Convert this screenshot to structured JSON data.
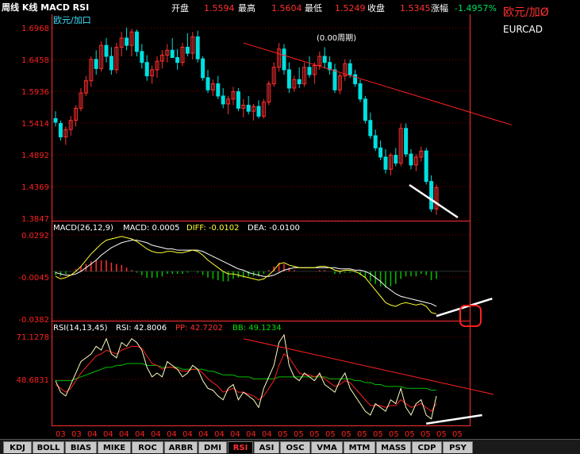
{
  "header": {
    "title": "周线 K线 MACD RSI",
    "open_label": "开盘",
    "open_value": "1.5594",
    "high_label": "最高",
    "high_value": "1.5604",
    "low_label": "最低",
    "low_value": "1.5249",
    "close_label": "收盘",
    "close_value": "1.5345",
    "change_label": "涨幅",
    "change_value": "-1.4957%"
  },
  "right_panel": {
    "name_cn": "欧元/加Ø",
    "name_en": "EURCAD"
  },
  "price_panel": {
    "label": "欧元/加口",
    "annotation": "(0.00周期)",
    "y_ticks": [
      "1.6968",
      "1.6458",
      "1.5936",
      "1.5414",
      "1.4892",
      "1.4369",
      "1.3847"
    ]
  },
  "macd_panel": {
    "label": "MACD(26,12,9)",
    "macd_text": "MACD: 0.0005",
    "diff_text": "DIFF: -0.0102",
    "dea_text": "DEA: -0.0100",
    "y_ticks": [
      "0.0292",
      "-0.0045",
      "-0.0382"
    ]
  },
  "rsi_panel": {
    "label": "RSI(14,13,45)",
    "rsi_text": "RSI: 42.8006",
    "pp_text": "PP: 42.7202",
    "bb_text": "BB: 49.1234",
    "y_ticks": [
      "71.1278",
      "48.6831"
    ]
  },
  "x_ticks": [
    "03",
    "03",
    "04",
    "04",
    "04",
    "04",
    "04",
    "04",
    "04",
    "04",
    "04",
    "04",
    "04",
    "04",
    "05",
    "05",
    "05",
    "05",
    "05",
    "05",
    "05",
    "05",
    "05",
    "05",
    "05",
    "05"
  ],
  "tabs": [
    "KDJ",
    "BOLL",
    "BIAS",
    "MIKE",
    "ROC",
    "ARBR",
    "DMI",
    "RSI",
    "ASI",
    "OSC",
    "VMA",
    "MTM",
    "MASS",
    "CDP",
    "PSY"
  ],
  "active_tab": "RSI",
  "colors": {
    "up": "#ff3030",
    "down": "#00e0e0",
    "grid": "#800000",
    "axis": "#ff3030",
    "yellow": "#ffff30",
    "white": "#ffffff",
    "green": "#00c000",
    "red": "#ff2020"
  },
  "chart_data": [
    {
      "type": "candlestick",
      "ylim": [
        1.3847,
        1.6968
      ],
      "candles": [
        [
          1.548,
          1.56,
          1.535,
          1.542
        ],
        [
          1.54,
          1.545,
          1.512,
          1.518
        ],
        [
          1.518,
          1.535,
          1.505,
          1.53
        ],
        [
          1.53,
          1.552,
          1.52,
          1.545
        ],
        [
          1.545,
          1.57,
          1.535,
          1.565
        ],
        [
          1.565,
          1.598,
          1.56,
          1.59
        ],
        [
          1.59,
          1.618,
          1.585,
          1.61
        ],
        [
          1.61,
          1.65,
          1.6,
          1.645
        ],
        [
          1.645,
          1.66,
          1.62,
          1.63
        ],
        [
          1.63,
          1.675,
          1.625,
          1.668
        ],
        [
          1.668,
          1.68,
          1.64,
          1.65
        ],
        [
          1.65,
          1.665,
          1.62,
          1.628
        ],
        [
          1.628,
          1.672,
          1.622,
          1.665
        ],
        [
          1.665,
          1.69,
          1.65,
          1.68
        ],
        [
          1.68,
          1.697,
          1.66,
          1.668
        ],
        [
          1.668,
          1.695,
          1.65,
          1.69
        ],
        [
          1.69,
          1.694,
          1.65,
          1.658
        ],
        [
          1.658,
          1.67,
          1.63,
          1.64
        ],
        [
          1.64,
          1.652,
          1.61,
          1.618
        ],
        [
          1.618,
          1.635,
          1.605,
          1.628
        ],
        [
          1.628,
          1.65,
          1.615,
          1.642
        ],
        [
          1.642,
          1.66,
          1.63,
          1.652
        ],
        [
          1.652,
          1.67,
          1.64,
          1.66
        ],
        [
          1.66,
          1.68,
          1.648,
          1.648
        ],
        [
          1.648,
          1.662,
          1.628,
          1.64
        ],
        [
          1.64,
          1.672,
          1.634,
          1.665
        ],
        [
          1.665,
          1.688,
          1.65,
          1.655
        ],
        [
          1.655,
          1.69,
          1.645,
          1.682
        ],
        [
          1.682,
          1.692,
          1.64,
          1.646
        ],
        [
          1.646,
          1.65,
          1.61,
          1.615
        ],
        [
          1.615,
          1.628,
          1.59,
          1.595
        ],
        [
          1.595,
          1.612,
          1.585,
          1.605
        ],
        [
          1.605,
          1.618,
          1.58,
          1.585
        ],
        [
          1.585,
          1.598,
          1.565,
          1.572
        ],
        [
          1.572,
          1.585,
          1.555,
          1.58
        ],
        [
          1.58,
          1.6,
          1.57,
          1.592
        ],
        [
          1.592,
          1.598,
          1.56,
          1.565
        ],
        [
          1.565,
          1.58,
          1.55,
          1.57
        ],
        [
          1.57,
          1.585,
          1.555,
          1.56
        ],
        [
          1.56,
          1.572,
          1.545,
          1.568
        ],
        [
          1.568,
          1.578,
          1.548,
          1.552
        ],
        [
          1.552,
          1.58,
          1.548,
          1.575
        ],
        [
          1.575,
          1.61,
          1.57,
          1.605
        ],
        [
          1.605,
          1.64,
          1.6,
          1.632
        ],
        [
          1.632,
          1.672,
          1.625,
          1.662
        ],
        [
          1.662,
          1.67,
          1.62,
          1.628
        ],
        [
          1.628,
          1.64,
          1.59,
          1.598
        ],
        [
          1.598,
          1.618,
          1.592,
          1.612
        ],
        [
          1.612,
          1.632,
          1.598,
          1.605
        ],
        [
          1.605,
          1.64,
          1.6,
          1.632
        ],
        [
          1.632,
          1.65,
          1.615,
          1.62
        ],
        [
          1.62,
          1.64,
          1.605,
          1.635
        ],
        [
          1.635,
          1.658,
          1.628,
          1.65
        ],
        [
          1.65,
          1.665,
          1.63,
          1.64
        ],
        [
          1.64,
          1.65,
          1.62,
          1.628
        ],
        [
          1.628,
          1.638,
          1.59,
          1.595
        ],
        [
          1.595,
          1.622,
          1.588,
          1.618
        ],
        [
          1.618,
          1.645,
          1.61,
          1.638
        ],
        [
          1.638,
          1.645,
          1.615,
          1.62
        ],
        [
          1.62,
          1.628,
          1.6,
          1.605
        ],
        [
          1.605,
          1.612,
          1.575,
          1.58
        ],
        [
          1.58,
          1.585,
          1.54,
          1.545
        ],
        [
          1.545,
          1.558,
          1.515,
          1.52
        ],
        [
          1.52,
          1.53,
          1.495,
          1.5
        ],
        [
          1.5,
          1.512,
          1.48,
          1.485
        ],
        [
          1.485,
          1.498,
          1.458,
          1.465
        ],
        [
          1.465,
          1.492,
          1.455,
          1.488
        ],
        [
          1.488,
          1.5,
          1.47,
          1.475
        ],
        [
          1.475,
          1.54,
          1.47,
          1.532
        ],
        [
          1.532,
          1.54,
          1.485,
          1.49
        ],
        [
          1.49,
          1.498,
          1.465,
          1.472
        ],
        [
          1.472,
          1.49,
          1.462,
          1.485
        ],
        [
          1.485,
          1.502,
          1.478,
          1.495
        ],
        [
          1.495,
          1.5,
          1.44,
          1.445
        ],
        [
          1.445,
          1.455,
          1.395,
          1.4
        ],
        [
          1.4,
          1.44,
          1.39,
          1.435
        ]
      ],
      "trendline": [
        [
          37,
          1.672
        ],
        [
          83,
          1.555
        ]
      ]
    },
    {
      "type": "line",
      "ylim": [
        -0.0382,
        0.0292
      ],
      "series": [
        {
          "name": "DIFF",
          "values": [
            -0.004,
            -0.006,
            -0.005,
            -0.003,
            0.0,
            0.004,
            0.009,
            0.014,
            0.018,
            0.022,
            0.025,
            0.026,
            0.027,
            0.028,
            0.027,
            0.026,
            0.024,
            0.021,
            0.018,
            0.016,
            0.015,
            0.015,
            0.016,
            0.016,
            0.015,
            0.015,
            0.016,
            0.017,
            0.016,
            0.013,
            0.009,
            0.006,
            0.003,
            0.0,
            -0.002,
            -0.002,
            -0.003,
            -0.004,
            -0.005,
            -0.006,
            -0.007,
            -0.006,
            -0.003,
            0.001,
            0.006,
            0.007,
            0.005,
            0.004,
            0.003,
            0.003,
            0.003,
            0.003,
            0.004,
            0.004,
            0.003,
            0.001,
            0.0,
            0.001,
            0.001,
            0.0,
            -0.002,
            -0.005,
            -0.01,
            -0.015,
            -0.02,
            -0.025,
            -0.027,
            -0.028,
            -0.026,
            -0.025,
            -0.026,
            -0.027,
            -0.026,
            -0.028,
            -0.033,
            -0.034
          ]
        },
        {
          "name": "DEA",
          "values": [
            -0.001,
            -0.002,
            -0.003,
            -0.003,
            -0.002,
            0.0,
            0.003,
            0.006,
            0.009,
            0.013,
            0.016,
            0.019,
            0.021,
            0.023,
            0.024,
            0.025,
            0.025,
            0.024,
            0.023,
            0.021,
            0.02,
            0.019,
            0.018,
            0.018,
            0.017,
            0.017,
            0.017,
            0.017,
            0.017,
            0.016,
            0.014,
            0.012,
            0.01,
            0.008,
            0.006,
            0.004,
            0.002,
            0.001,
            -0.001,
            -0.002,
            -0.003,
            -0.004,
            -0.004,
            -0.003,
            -0.001,
            0.001,
            0.002,
            0.003,
            0.003,
            0.003,
            0.003,
            0.003,
            0.003,
            0.003,
            0.003,
            0.003,
            0.002,
            0.002,
            0.002,
            0.001,
            0.001,
            0.0,
            -0.002,
            -0.005,
            -0.008,
            -0.012,
            -0.015,
            -0.018,
            -0.02,
            -0.021,
            -0.022,
            -0.023,
            -0.024,
            -0.025,
            -0.026,
            -0.028
          ]
        },
        {
          "name": "MACD",
          "type": "histogram",
          "values": [
            -0.003,
            -0.004,
            -0.002,
            0.0,
            0.002,
            0.004,
            0.006,
            0.008,
            0.009,
            0.009,
            0.009,
            0.007,
            0.006,
            0.005,
            0.003,
            0.001,
            -0.001,
            -0.003,
            -0.005,
            -0.005,
            -0.005,
            -0.004,
            -0.002,
            -0.002,
            -0.002,
            -0.002,
            -0.001,
            0.0,
            -0.001,
            -0.003,
            -0.005,
            -0.006,
            -0.007,
            -0.008,
            -0.008,
            -0.006,
            -0.005,
            -0.005,
            -0.004,
            -0.004,
            -0.004,
            -0.002,
            0.001,
            0.004,
            0.007,
            0.006,
            0.003,
            0.001,
            0.0,
            0.0,
            0.0,
            0.0,
            0.001,
            0.001,
            0.0,
            -0.002,
            -0.002,
            -0.001,
            -0.001,
            -0.001,
            -0.003,
            -0.005,
            -0.008,
            -0.01,
            -0.012,
            -0.013,
            -0.012,
            -0.01,
            -0.006,
            -0.004,
            -0.004,
            -0.004,
            -0.002,
            -0.003,
            -0.007,
            -0.006
          ]
        }
      ],
      "trendline": [
        [
          75,
          -0.0358
        ],
        [
          86,
          -0.0218
        ]
      ]
    },
    {
      "type": "line",
      "ylim": [
        25,
        71.1278
      ],
      "series": [
        {
          "name": "RSI",
          "values": [
            48,
            42,
            40,
            46,
            52,
            58,
            60,
            62,
            66,
            64,
            70,
            62,
            60,
            68,
            66,
            70,
            68,
            64,
            55,
            50,
            52,
            50,
            58,
            56,
            54,
            50,
            52,
            56,
            54,
            48,
            44,
            43,
            40,
            38,
            44,
            46,
            38,
            42,
            40,
            38,
            34,
            44,
            50,
            56,
            68,
            72,
            56,
            50,
            48,
            52,
            50,
            48,
            52,
            46,
            44,
            42,
            48,
            52,
            44,
            40,
            36,
            32,
            30,
            36,
            34,
            32,
            38,
            36,
            44,
            34,
            30,
            36,
            38,
            30,
            28,
            40
          ]
        },
        {
          "name": "PP",
          "values": [
            46,
            44,
            42,
            44,
            48,
            52,
            55,
            58,
            61,
            62,
            64,
            63,
            62,
            64,
            65,
            66,
            66,
            65,
            61,
            57,
            56,
            54,
            55,
            55,
            54,
            53,
            53,
            54,
            54,
            52,
            49,
            47,
            45,
            42,
            43,
            44,
            42,
            42,
            41,
            40,
            38,
            40,
            44,
            48,
            56,
            62,
            60,
            56,
            52,
            51,
            51,
            50,
            51,
            49,
            47,
            45,
            46,
            48,
            47,
            44,
            41,
            38,
            35,
            35,
            35,
            34,
            35,
            35,
            38,
            36,
            34,
            35,
            36,
            34,
            32,
            36
          ]
        },
        {
          "name": "BB",
          "values": [
            48,
            48,
            48,
            48,
            49,
            50,
            51,
            52,
            53,
            54,
            55,
            55,
            56,
            56,
            57,
            57,
            57,
            57,
            56,
            56,
            56,
            55,
            55,
            55,
            55,
            54,
            54,
            54,
            54,
            54,
            53,
            53,
            52,
            51,
            51,
            51,
            50,
            50,
            50,
            49,
            49,
            49,
            49,
            49,
            50,
            50,
            50,
            50,
            50,
            50,
            50,
            50,
            50,
            50,
            49,
            49,
            49,
            49,
            49,
            48,
            48,
            47,
            47,
            46,
            46,
            45,
            45,
            45,
            45,
            44,
            44,
            44,
            44,
            44,
            43,
            43
          ]
        }
      ],
      "trendlines": [
        {
          "color": "red",
          "points": [
            [
              37,
              70
            ],
            [
              86,
              41
            ]
          ]
        },
        {
          "color": "white",
          "points": [
            [
              73,
              25.5
            ],
            [
              84,
              30
            ]
          ]
        }
      ]
    }
  ]
}
